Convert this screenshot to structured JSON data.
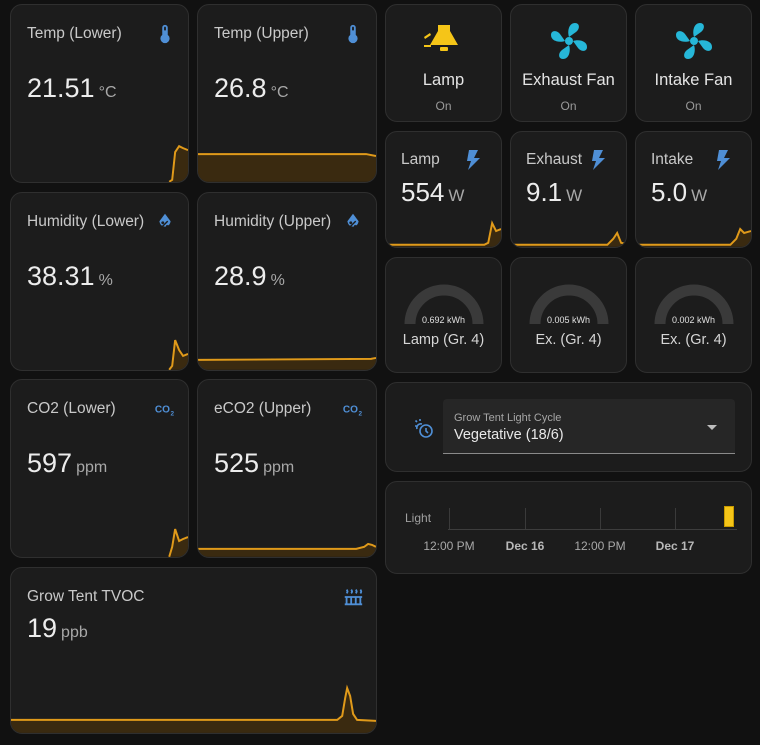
{
  "sensors": {
    "temp_lower": {
      "name": "Temp (Lower)",
      "value": "21.51",
      "unit": "°C",
      "icon": "thermometer-icon"
    },
    "temp_upper": {
      "name": "Temp (Upper)",
      "value": "26.8",
      "unit": "°C",
      "icon": "thermometer-icon"
    },
    "hum_lower": {
      "name": "Humidity (Lower)",
      "value": "38.31",
      "unit": "%",
      "icon": "water-percent-icon"
    },
    "hum_upper": {
      "name": "Humidity (Upper)",
      "value": "28.9",
      "unit": "%",
      "icon": "water-percent-icon"
    },
    "co2_lower": {
      "name": "CO2 (Lower)",
      "value": "597",
      "unit": "ppm",
      "icon": "co2-icon"
    },
    "eco2_upper": {
      "name": "eCO2 (Upper)",
      "value": "525",
      "unit": "ppm",
      "icon": "co2-icon"
    },
    "tvoc": {
      "name": "Grow Tent TVOC",
      "value": "19",
      "unit": "ppb",
      "icon": "air-filter-icon"
    }
  },
  "tiles": {
    "lamp": {
      "name": "Lamp",
      "state": "On",
      "icon": "lamp-icon"
    },
    "exhaust": {
      "name": "Exhaust Fan",
      "state": "On",
      "icon": "fan-icon"
    },
    "intake": {
      "name": "Intake Fan",
      "state": "On",
      "icon": "fan-icon"
    }
  },
  "power": {
    "lamp": {
      "name": "Lamp",
      "value": "554",
      "unit": "W",
      "icon": "flash-icon"
    },
    "exhaust": {
      "name": "Exhaust",
      "value": "9.1",
      "unit": "W",
      "icon": "flash-icon"
    },
    "intake": {
      "name": "Intake",
      "value": "5.0",
      "unit": "W",
      "icon": "flash-icon"
    }
  },
  "energy": {
    "lamp": {
      "name": "Lamp (Gr. 4)",
      "value": "0.692 kWh"
    },
    "exhaust": {
      "name": "Ex. (Gr. 4)",
      "value": "0.005 kWh"
    },
    "intake": {
      "name": "Ex. (Gr. 4)",
      "value": "0.002 kWh"
    }
  },
  "light_cycle": {
    "label": "Grow Tent Light Cycle",
    "selected": "Vegetative (18/6)",
    "icon": "sun-clock-icon"
  },
  "history": {
    "entity": "Light",
    "ticks": [
      "12:00 PM",
      "Dec 16",
      "12:00 PM",
      "Dec 17"
    ],
    "state_color": "#f5c518"
  },
  "colors": {
    "accent": "#e09a1a",
    "icon_blue": "#4f8fd6",
    "fan": "#26b7d8",
    "lamp": "#f5c518"
  }
}
